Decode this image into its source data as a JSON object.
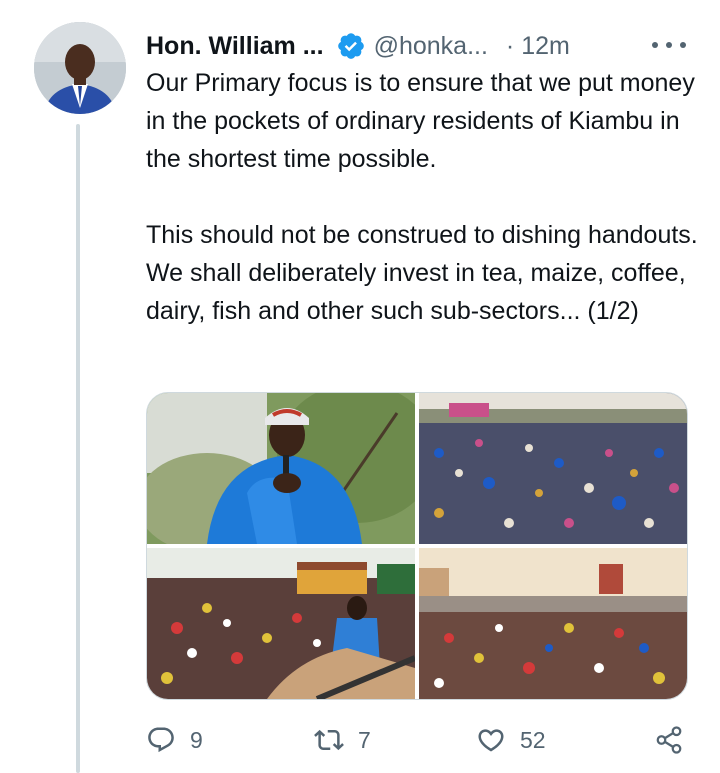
{
  "tweet": {
    "author_name": "Hon. William ...",
    "handle": "@honka...",
    "time": "· 12m",
    "verified_icon": "verified-badge-icon",
    "more_icon": "more-horizontal-icon",
    "paragraphs": [
      "Our Primary focus is to ensure that we put money in the pockets of ordinary residents of Kiambu in the shortest time possible.",
      "This should not be construed to dishing handouts. We shall deliberately invest in tea, maize, coffee, dairy, fish and other such sub-sectors... (1/2)"
    ]
  },
  "media": {
    "photos": [
      {
        "name": "speaker-photo"
      },
      {
        "name": "crowd-photo-1"
      },
      {
        "name": "crowd-photo-2"
      },
      {
        "name": "crowd-photo-3"
      }
    ]
  },
  "actions": {
    "reply": {
      "icon": "reply-icon",
      "count": "9"
    },
    "retweet": {
      "icon": "retweet-icon",
      "count": "7"
    },
    "like": {
      "icon": "heart-icon",
      "count": "52"
    },
    "share": {
      "icon": "share-icon"
    }
  },
  "colors": {
    "text": "#0f1419",
    "secondary": "#536471",
    "verified": "#1d9bf0",
    "thread_line": "#cfd9de"
  }
}
